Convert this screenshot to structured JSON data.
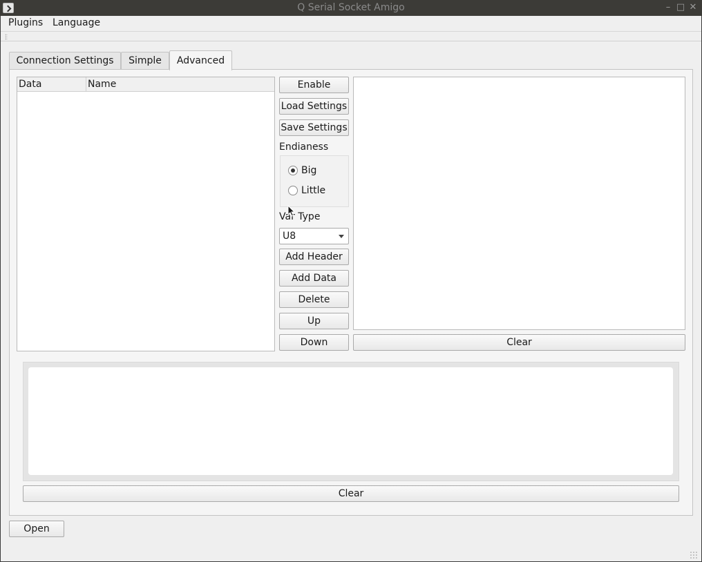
{
  "window": {
    "title": "Q Serial Socket Amigo",
    "controls": {
      "minimize": "–",
      "maximize": "□",
      "close": "✕"
    }
  },
  "menubar": {
    "items": [
      "Plugins",
      "Language"
    ]
  },
  "tabs": [
    {
      "label": "Connection Settings",
      "active": false
    },
    {
      "label": "Simple",
      "active": false
    },
    {
      "label": "Advanced",
      "active": true
    }
  ],
  "advanced": {
    "list_columns": [
      "Data",
      "Name"
    ],
    "buttons": {
      "enable": "Enable",
      "load_settings": "Load Settings",
      "save_settings": "Save Settings",
      "add_header": "Add Header",
      "add_data": "Add Data",
      "delete": "Delete",
      "up": "Up",
      "down": "Down",
      "clear_right": "Clear",
      "clear_bottom": "Clear"
    },
    "endianess": {
      "label": "Endianess",
      "options": [
        "Big",
        "Little"
      ],
      "selected": "Big"
    },
    "var_type": {
      "label": "Var Type",
      "value": "U8"
    }
  },
  "footer": {
    "open_button": "Open"
  },
  "colors": {
    "titlebar": "#3c3b37",
    "panel": "#f5f5f5",
    "window_bg": "#efefef"
  }
}
